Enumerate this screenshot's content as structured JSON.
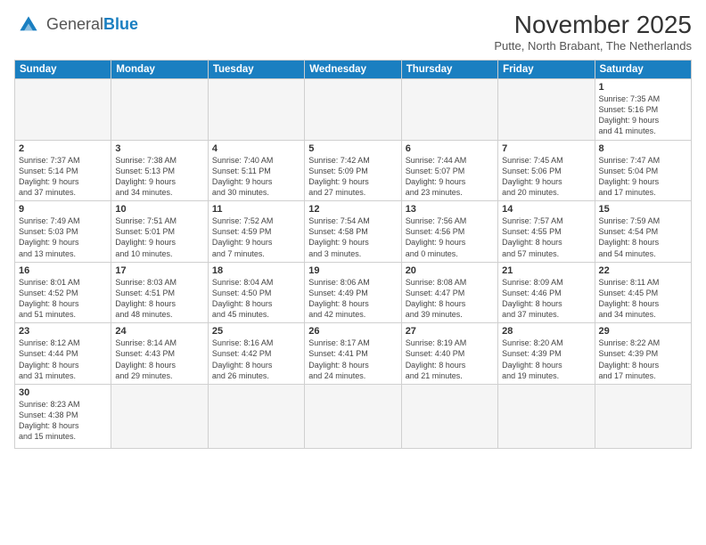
{
  "header": {
    "logo_general": "General",
    "logo_blue": "Blue",
    "month_year": "November 2025",
    "subtitle": "Putte, North Brabant, The Netherlands"
  },
  "weekdays": [
    "Sunday",
    "Monday",
    "Tuesday",
    "Wednesday",
    "Thursday",
    "Friday",
    "Saturday"
  ],
  "weeks": [
    [
      {
        "day": "",
        "info": ""
      },
      {
        "day": "",
        "info": ""
      },
      {
        "day": "",
        "info": ""
      },
      {
        "day": "",
        "info": ""
      },
      {
        "day": "",
        "info": ""
      },
      {
        "day": "",
        "info": ""
      },
      {
        "day": "1",
        "info": "Sunrise: 7:35 AM\nSunset: 5:16 PM\nDaylight: 9 hours\nand 41 minutes."
      }
    ],
    [
      {
        "day": "2",
        "info": "Sunrise: 7:37 AM\nSunset: 5:14 PM\nDaylight: 9 hours\nand 37 minutes."
      },
      {
        "day": "3",
        "info": "Sunrise: 7:38 AM\nSunset: 5:13 PM\nDaylight: 9 hours\nand 34 minutes."
      },
      {
        "day": "4",
        "info": "Sunrise: 7:40 AM\nSunset: 5:11 PM\nDaylight: 9 hours\nand 30 minutes."
      },
      {
        "day": "5",
        "info": "Sunrise: 7:42 AM\nSunset: 5:09 PM\nDaylight: 9 hours\nand 27 minutes."
      },
      {
        "day": "6",
        "info": "Sunrise: 7:44 AM\nSunset: 5:07 PM\nDaylight: 9 hours\nand 23 minutes."
      },
      {
        "day": "7",
        "info": "Sunrise: 7:45 AM\nSunset: 5:06 PM\nDaylight: 9 hours\nand 20 minutes."
      },
      {
        "day": "8",
        "info": "Sunrise: 7:47 AM\nSunset: 5:04 PM\nDaylight: 9 hours\nand 17 minutes."
      }
    ],
    [
      {
        "day": "9",
        "info": "Sunrise: 7:49 AM\nSunset: 5:03 PM\nDaylight: 9 hours\nand 13 minutes."
      },
      {
        "day": "10",
        "info": "Sunrise: 7:51 AM\nSunset: 5:01 PM\nDaylight: 9 hours\nand 10 minutes."
      },
      {
        "day": "11",
        "info": "Sunrise: 7:52 AM\nSunset: 4:59 PM\nDaylight: 9 hours\nand 7 minutes."
      },
      {
        "day": "12",
        "info": "Sunrise: 7:54 AM\nSunset: 4:58 PM\nDaylight: 9 hours\nand 3 minutes."
      },
      {
        "day": "13",
        "info": "Sunrise: 7:56 AM\nSunset: 4:56 PM\nDaylight: 9 hours\nand 0 minutes."
      },
      {
        "day": "14",
        "info": "Sunrise: 7:57 AM\nSunset: 4:55 PM\nDaylight: 8 hours\nand 57 minutes."
      },
      {
        "day": "15",
        "info": "Sunrise: 7:59 AM\nSunset: 4:54 PM\nDaylight: 8 hours\nand 54 minutes."
      }
    ],
    [
      {
        "day": "16",
        "info": "Sunrise: 8:01 AM\nSunset: 4:52 PM\nDaylight: 8 hours\nand 51 minutes."
      },
      {
        "day": "17",
        "info": "Sunrise: 8:03 AM\nSunset: 4:51 PM\nDaylight: 8 hours\nand 48 minutes."
      },
      {
        "day": "18",
        "info": "Sunrise: 8:04 AM\nSunset: 4:50 PM\nDaylight: 8 hours\nand 45 minutes."
      },
      {
        "day": "19",
        "info": "Sunrise: 8:06 AM\nSunset: 4:49 PM\nDaylight: 8 hours\nand 42 minutes."
      },
      {
        "day": "20",
        "info": "Sunrise: 8:08 AM\nSunset: 4:47 PM\nDaylight: 8 hours\nand 39 minutes."
      },
      {
        "day": "21",
        "info": "Sunrise: 8:09 AM\nSunset: 4:46 PM\nDaylight: 8 hours\nand 37 minutes."
      },
      {
        "day": "22",
        "info": "Sunrise: 8:11 AM\nSunset: 4:45 PM\nDaylight: 8 hours\nand 34 minutes."
      }
    ],
    [
      {
        "day": "23",
        "info": "Sunrise: 8:12 AM\nSunset: 4:44 PM\nDaylight: 8 hours\nand 31 minutes."
      },
      {
        "day": "24",
        "info": "Sunrise: 8:14 AM\nSunset: 4:43 PM\nDaylight: 8 hours\nand 29 minutes."
      },
      {
        "day": "25",
        "info": "Sunrise: 8:16 AM\nSunset: 4:42 PM\nDaylight: 8 hours\nand 26 minutes."
      },
      {
        "day": "26",
        "info": "Sunrise: 8:17 AM\nSunset: 4:41 PM\nDaylight: 8 hours\nand 24 minutes."
      },
      {
        "day": "27",
        "info": "Sunrise: 8:19 AM\nSunset: 4:40 PM\nDaylight: 8 hours\nand 21 minutes."
      },
      {
        "day": "28",
        "info": "Sunrise: 8:20 AM\nSunset: 4:39 PM\nDaylight: 8 hours\nand 19 minutes."
      },
      {
        "day": "29",
        "info": "Sunrise: 8:22 AM\nSunset: 4:39 PM\nDaylight: 8 hours\nand 17 minutes."
      }
    ],
    [
      {
        "day": "30",
        "info": "Sunrise: 8:23 AM\nSunset: 4:38 PM\nDaylight: 8 hours\nand 15 minutes."
      },
      {
        "day": "",
        "info": ""
      },
      {
        "day": "",
        "info": ""
      },
      {
        "day": "",
        "info": ""
      },
      {
        "day": "",
        "info": ""
      },
      {
        "day": "",
        "info": ""
      },
      {
        "day": "",
        "info": ""
      }
    ]
  ]
}
